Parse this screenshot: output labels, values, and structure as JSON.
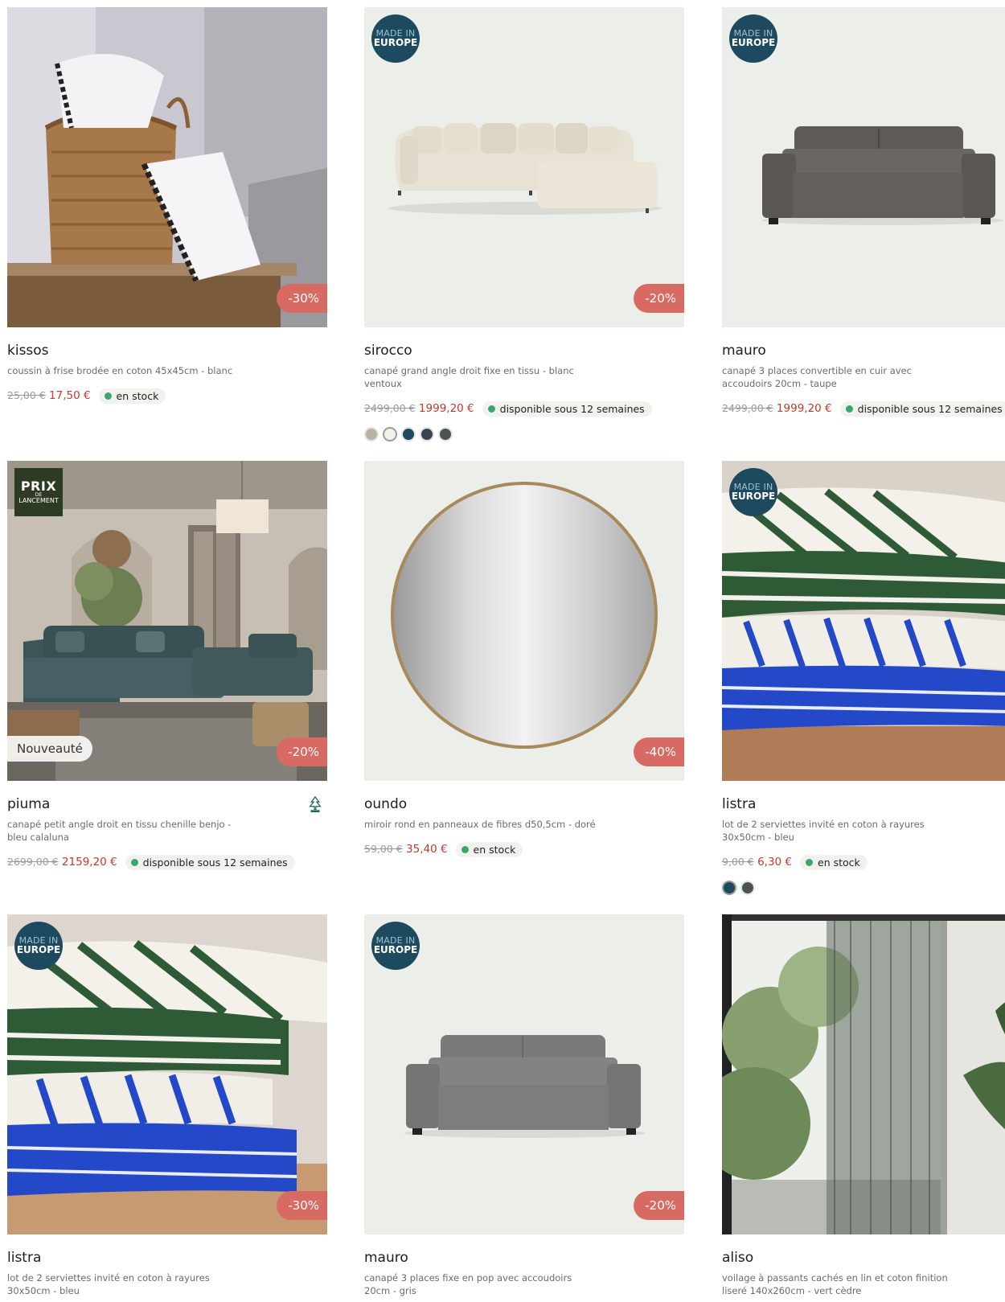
{
  "products": [
    {
      "name": "kissos",
      "desc": "coussin à frise brodée en coton 45x45cm - blanc",
      "old_price": "25,00 €",
      "new_price": "17,50 €",
      "stock": "en stock",
      "discount": "-30%"
    },
    {
      "name": "sirocco",
      "desc": "canapé grand angle droit fixe en tissu - blanc ventoux",
      "old_price": "2499,00 €",
      "new_price": "1999,20 €",
      "stock": "disponible sous 12 semaines",
      "discount": "-20%",
      "badge_line1": "MADE IN",
      "badge_line2": "EUROPE",
      "swatches": [
        "#b8b2a5",
        "#f3f1ea",
        "#1d4a5e",
        "#3e4350",
        "#4b544e"
      ]
    },
    {
      "name": "mauro",
      "desc": "canapé 3 places convertible en cuir avec accoudoirs 20cm - taupe",
      "old_price": "2499,00 €",
      "new_price": "1999,20 €",
      "stock": "disponible sous 12 semaines",
      "badge_line1": "MADE IN",
      "badge_line2": "EUROPE"
    },
    {
      "name": "piuma",
      "desc": "canapé petit angle droit en tissu chenille benjo - bleu calaluna",
      "old_price": "2699,00 €",
      "new_price": "2159,20 €",
      "stock": "disponible sous 12 semaines",
      "discount": "-20%",
      "launch_line1": "PRIX",
      "launch_line2": "DE",
      "launch_line3": "LANCEMENT",
      "new_label": "Nouveauté"
    },
    {
      "name": "oundo",
      "desc": "miroir rond en panneaux de fibres d50,5cm - doré",
      "old_price": "59,00 €",
      "new_price": "35,40 €",
      "stock": "en stock",
      "discount": "-40%"
    },
    {
      "name": "listra",
      "desc": "lot de 2 serviettes invité en coton à rayures 30x50cm - bleu",
      "old_price": "9,00 €",
      "new_price": "6,30 €",
      "stock": "en stock",
      "badge_line1": "MADE IN",
      "badge_line2": "EUROPE",
      "swatches": [
        "#1d4a5e",
        "#4b544e"
      ]
    },
    {
      "name": "listra",
      "desc": "lot de 2 serviettes invité en coton à rayures 30x50cm - bleu",
      "discount": "-30%",
      "badge_line1": "MADE IN",
      "badge_line2": "EUROPE"
    },
    {
      "name": "mauro",
      "desc": "canapé 3 places fixe en pop avec accoudoirs 20cm - gris",
      "discount": "-20%",
      "badge_line1": "MADE IN",
      "badge_line2": "EUROPE"
    },
    {
      "name": "aliso",
      "desc": "voilage à passants cachés en lin et coton finition liseré 140x260cm - vert cèdre"
    }
  ]
}
